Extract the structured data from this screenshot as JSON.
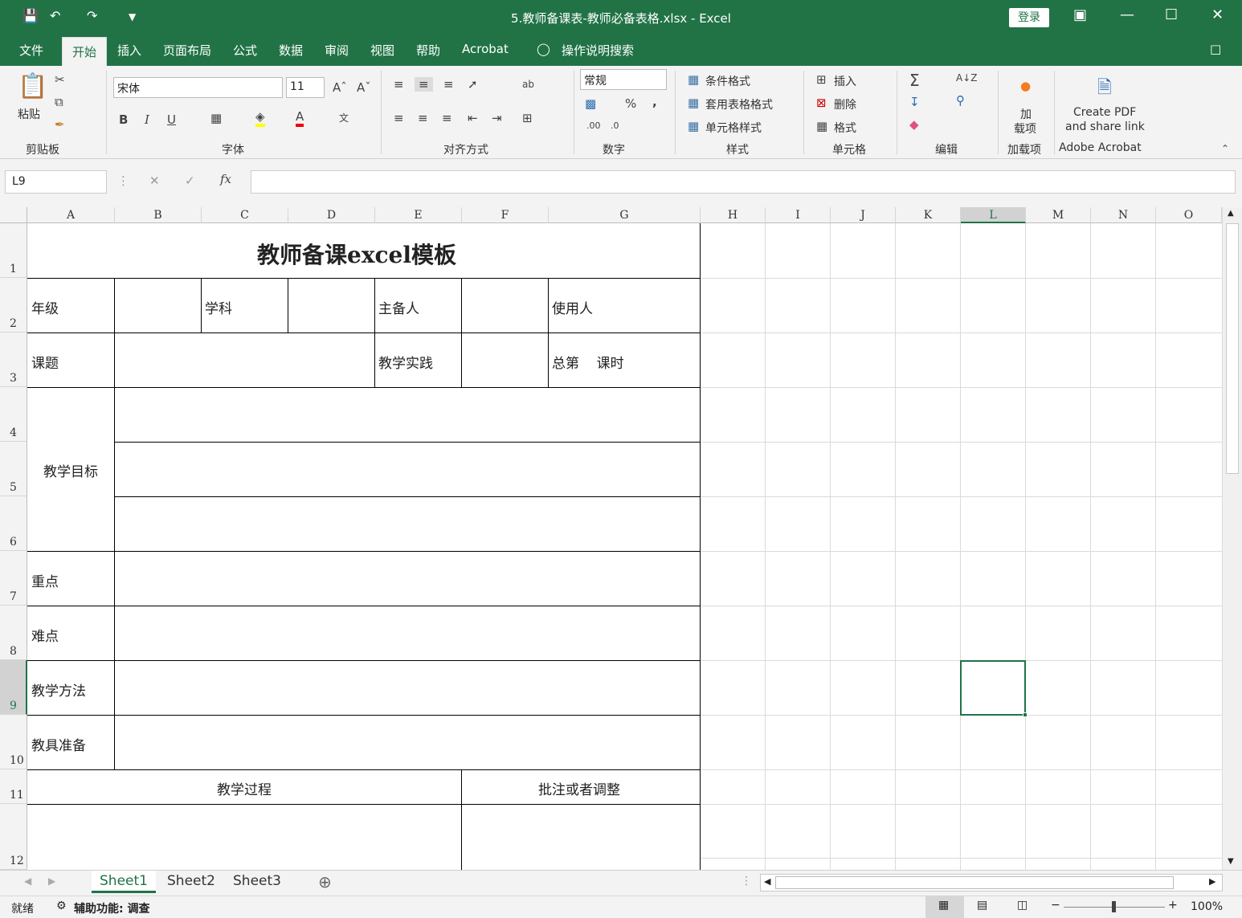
{
  "window": {
    "title": "5.教师备课表-教师必备表格.xlsx  -  Excel",
    "login_label": "登录"
  },
  "tabs": [
    "文件",
    "开始",
    "插入",
    "页面布局",
    "公式",
    "数据",
    "审阅",
    "视图",
    "帮助",
    "Acrobat",
    "操作说明搜索"
  ],
  "ribbon": {
    "clipboard": {
      "paste": "粘贴",
      "label": "剪贴板"
    },
    "font": {
      "name": "宋体",
      "size": "11",
      "label": "字体"
    },
    "alignment": {
      "label": "对齐方式"
    },
    "number": {
      "format": "常规",
      "label": "数字"
    },
    "styles": {
      "conditional": "条件格式",
      "table": "套用表格格式",
      "cell": "单元格样式",
      "label": "样式"
    },
    "cells": {
      "insert": "插入",
      "delete": "删除",
      "format": "格式",
      "label": "单元格"
    },
    "editing": {
      "label": "编辑"
    },
    "addins": {
      "line1": "加",
      "line2": "载项",
      "label": "加载项"
    },
    "acrobat": {
      "line1": "Create PDF",
      "line2": "and share link",
      "label": "Adobe Acrobat"
    }
  },
  "formula_bar": {
    "name_box": "L9",
    "formula": ""
  },
  "columns": [
    "A",
    "B",
    "C",
    "D",
    "E",
    "F",
    "G",
    "H",
    "I",
    "J",
    "K",
    "L",
    "M",
    "N",
    "O"
  ],
  "rows": [
    "1",
    "2",
    "3",
    "4",
    "5",
    "6",
    "7",
    "8",
    "9",
    "10",
    "11",
    "12"
  ],
  "cells": {
    "title": "教师备课excel模板",
    "grade": "年级",
    "subject": "学科",
    "lead": "主备人",
    "user": "使用人",
    "topic": "课题",
    "practice": "教学实践",
    "period": "总第    课时",
    "objectives": "教学目标",
    "key_points": "重点",
    "difficulties": "难点",
    "methods": "教学方法",
    "tools": "教具准备",
    "process": "教学过程",
    "notes": "批注或者调整"
  },
  "sheets": [
    "Sheet1",
    "Sheet2",
    "Sheet3"
  ],
  "status": {
    "ready": "就绪",
    "accessibility": "辅助功能: 调查",
    "zoom": "100%"
  }
}
